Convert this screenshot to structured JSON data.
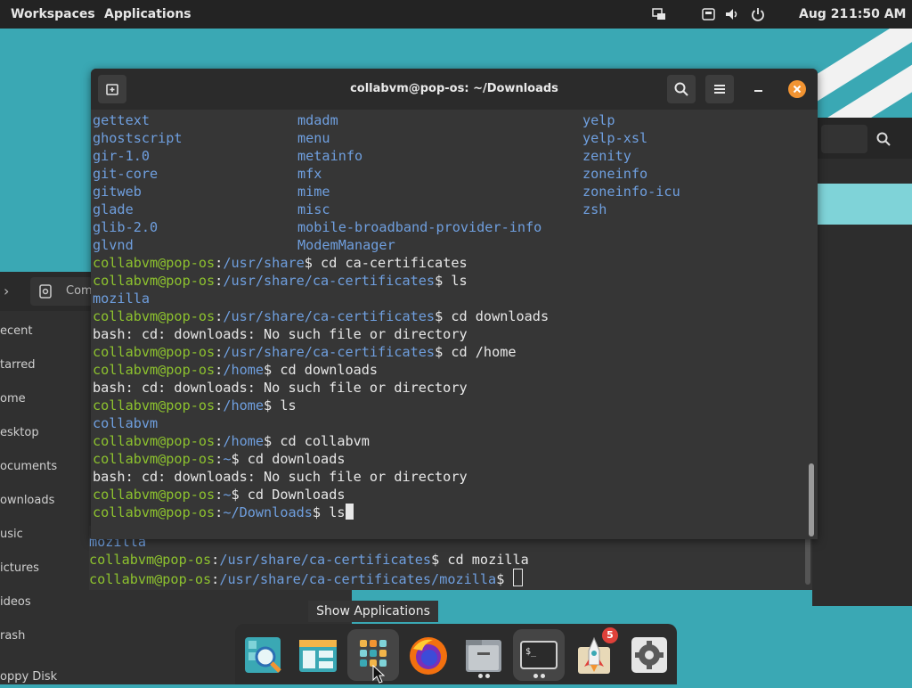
{
  "topbar": {
    "workspaces": "Workspaces",
    "applications": "Applications",
    "date": "Aug 21",
    "time": "1:50 AM"
  },
  "files": {
    "location_partial": "Com",
    "sidebar": [
      "ecent",
      "tarred",
      "ome",
      "esktop",
      "ocuments",
      "ownloads",
      "usic",
      "ictures",
      "ideos",
      "rash"
    ],
    "partial_bottom": "oppy Disk"
  },
  "terminal": {
    "title": "collabvm@pop-os: ~/Downloads",
    "user": "collabvm@pop-os",
    "listing": [
      [
        "gettext",
        "mdadm",
        "yelp"
      ],
      [
        "ghostscript",
        "menu",
        "yelp-xsl"
      ],
      [
        "gir-1.0",
        "metainfo",
        "zenity"
      ],
      [
        "git-core",
        "mfx",
        "zoneinfo"
      ],
      [
        "gitweb",
        "mime",
        "zoneinfo-icu"
      ],
      [
        "glade",
        "misc",
        "zsh"
      ],
      [
        "glib-2.0",
        "mobile-broadband-provider-info",
        ""
      ],
      [
        "glvnd",
        "ModemManager",
        ""
      ]
    ],
    "lines": [
      {
        "type": "prompt",
        "path": "/usr/share",
        "cmd": "cd ca-certificates"
      },
      {
        "type": "prompt",
        "path": "/usr/share/ca-certificates",
        "cmd": "ls"
      },
      {
        "type": "dir",
        "text": "mozilla"
      },
      {
        "type": "prompt",
        "path": "/usr/share/ca-certificates",
        "cmd": "cd downloads"
      },
      {
        "type": "out",
        "text": "bash: cd: downloads: No such file or directory"
      },
      {
        "type": "prompt",
        "path": "/usr/share/ca-certificates",
        "cmd": "cd /home"
      },
      {
        "type": "prompt",
        "path": "/home",
        "cmd": "cd downloads"
      },
      {
        "type": "out",
        "text": "bash: cd: downloads: No such file or directory"
      },
      {
        "type": "prompt",
        "path": "/home",
        "cmd": "ls"
      },
      {
        "type": "dir",
        "text": "collabvm"
      },
      {
        "type": "prompt",
        "path": "/home",
        "cmd": "cd collabvm"
      },
      {
        "type": "prompt",
        "path": "~",
        "cmd": "cd downloads"
      },
      {
        "type": "out",
        "text": "bash: cd: downloads: No such file or directory"
      },
      {
        "type": "prompt",
        "path": "~",
        "cmd": "cd Downloads"
      },
      {
        "type": "prompt",
        "path": "~/Downloads",
        "cmd": "ls",
        "cursor": true
      }
    ]
  },
  "behind_terminal": {
    "lines": [
      {
        "type": "dir",
        "text": "mozilla"
      },
      {
        "type": "prompt",
        "path": "/usr/share/ca-certificates",
        "cmd": "cd mozilla"
      },
      {
        "type": "prompt",
        "path": "/usr/share/ca-certificates/mozilla",
        "cmd": "",
        "cursor": "box"
      }
    ]
  },
  "dock": {
    "tooltip": "Show Applications",
    "items": [
      "search-app",
      "files-app",
      "show-applications",
      "firefox",
      "file-manager",
      "terminal",
      "app-center",
      "settings"
    ],
    "badge": "5"
  },
  "colors": {
    "user": "#8dc22e",
    "path": "#6f9fdf",
    "wallpaper": "#3aa8b4",
    "close": "#f29432"
  }
}
